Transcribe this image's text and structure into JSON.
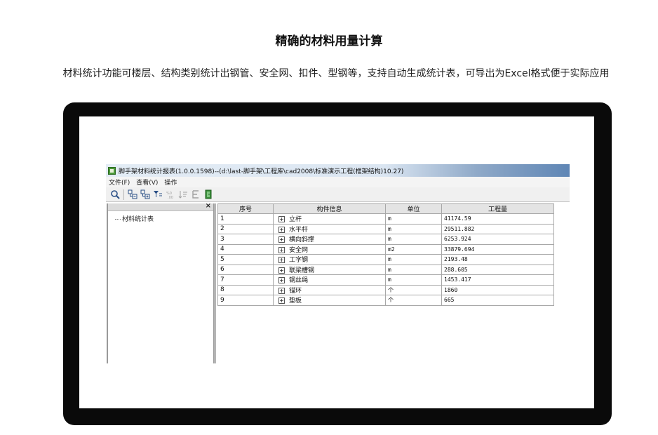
{
  "heading": {
    "title": "精确的材料用量计算",
    "subtitle": "材料统计功能可楼层、结构类别统计出钢管、安全网、扣件、型钢等，支持自动生成统计表，可导出为Excel格式便于实际应用"
  },
  "window": {
    "title": "脚手架材料统计报表(1.0.0.1598)--(d:\\last-脚手架\\工程库\\cad2008\\标准演示工程(框架结构)10.27)",
    "menu": [
      "文件(F)",
      "查看(V)",
      "操作"
    ],
    "toolbar_icons": [
      "search-zoom-icon",
      "tree-expand-icon",
      "tree-collapse-icon",
      "filter-icon",
      "decimal-icon",
      "sort-icon",
      "excel-e-icon",
      "door-exit-icon"
    ]
  },
  "left_pane": {
    "close_glyph": "×",
    "tree": [
      "材料统计表"
    ]
  },
  "table": {
    "headers": [
      "序号",
      "构件信息",
      "单位",
      "工程量"
    ],
    "rows": [
      {
        "idx": "1",
        "name": "立杆",
        "unit": "m",
        "qty": "41174.59"
      },
      {
        "idx": "2",
        "name": "水平杆",
        "unit": "m",
        "qty": "29511.882"
      },
      {
        "idx": "3",
        "name": "横向斜撑",
        "unit": "m",
        "qty": "6253.924"
      },
      {
        "idx": "4",
        "name": "安全网",
        "unit": "m2",
        "qty": "33879.694"
      },
      {
        "idx": "5",
        "name": "工字钢",
        "unit": "m",
        "qty": "2193.48"
      },
      {
        "idx": "6",
        "name": "联梁槽钢",
        "unit": "m",
        "qty": "288.605"
      },
      {
        "idx": "7",
        "name": "钢丝绳",
        "unit": "m",
        "qty": "1453.417"
      },
      {
        "idx": "8",
        "name": "锚环",
        "unit": "个",
        "qty": "1860"
      },
      {
        "idx": "9",
        "name": "垫板",
        "unit": "个",
        "qty": "665"
      }
    ],
    "expander_glyph": "+"
  }
}
